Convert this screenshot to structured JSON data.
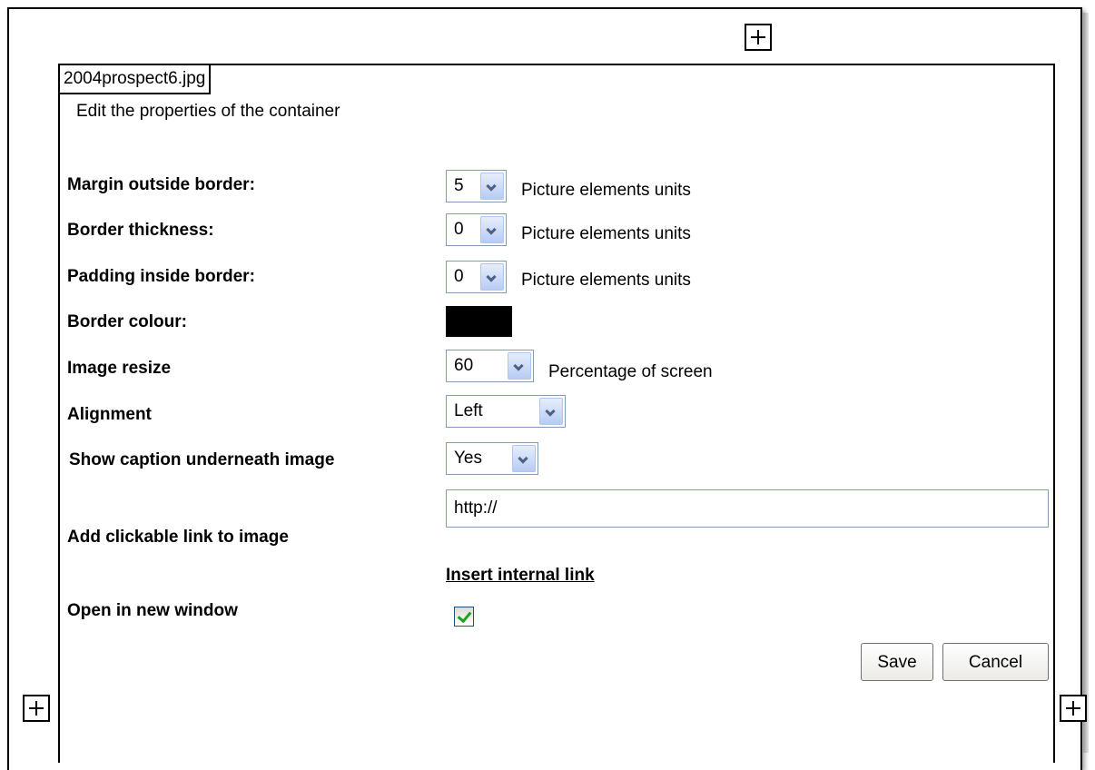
{
  "file": {
    "name": "2004prospect6.jpg"
  },
  "dialog": {
    "subtitle": "Edit the properties of the container"
  },
  "fields": {
    "margin": {
      "label": "Margin outside border:",
      "value": "5",
      "unit": "Picture elements units"
    },
    "border_thickness": {
      "label": "Border thickness:",
      "value": "0",
      "unit": "Picture elements units"
    },
    "padding": {
      "label": "Padding inside border:",
      "value": "0",
      "unit": "Picture elements units"
    },
    "border_colour": {
      "label": "Border colour:",
      "color": "#000000"
    },
    "image_resize": {
      "label": "Image resize",
      "value": "60",
      "unit": "Percentage of screen"
    },
    "alignment": {
      "label": "Alignment",
      "value": "Left"
    },
    "show_caption": {
      "label": "Show caption underneath image",
      "value": "Yes"
    },
    "link": {
      "label": "Add clickable link to image",
      "value": "http://",
      "insert_label": "Insert internal link"
    },
    "new_window": {
      "label": "Open in new window",
      "checked": true
    }
  },
  "buttons": {
    "save": "Save",
    "cancel": "Cancel"
  },
  "icons": [
    "expand-icon"
  ]
}
